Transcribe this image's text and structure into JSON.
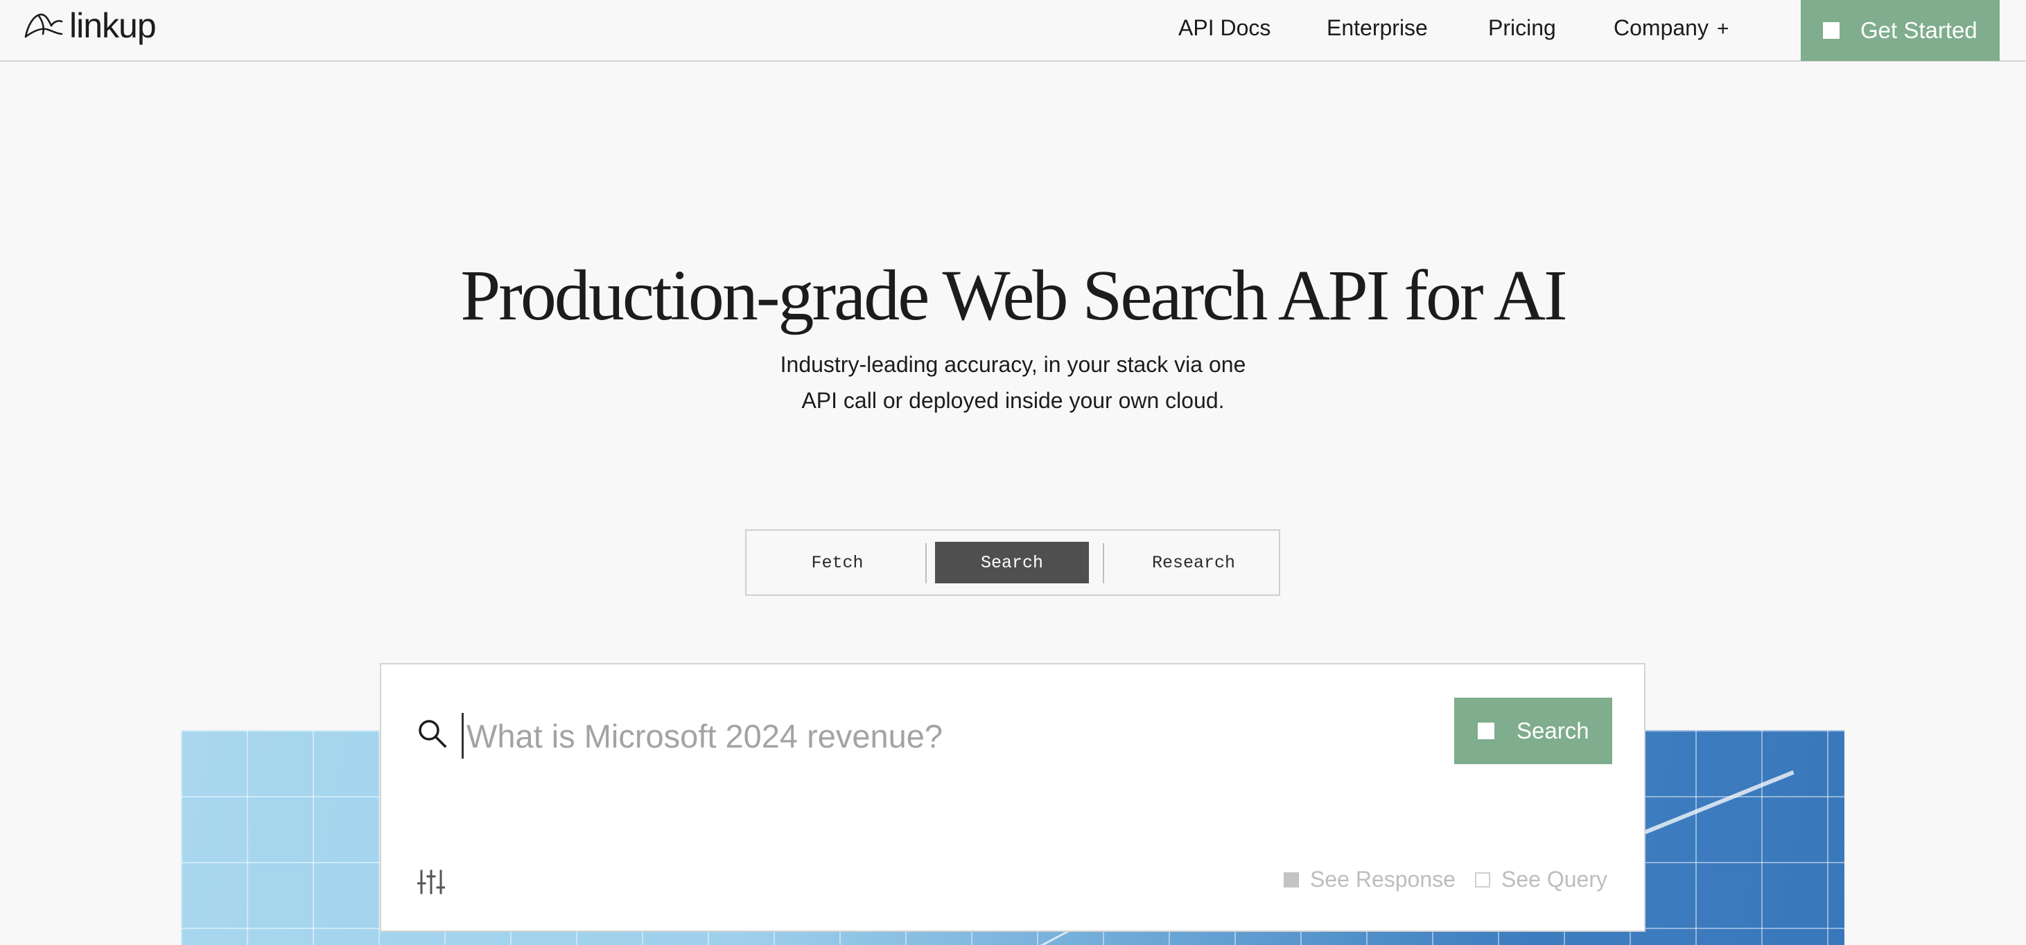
{
  "header": {
    "logo_text": "linkup",
    "nav": [
      {
        "label": "API Docs"
      },
      {
        "label": "Enterprise"
      },
      {
        "label": "Pricing"
      },
      {
        "label": "Company",
        "suffix": "+"
      }
    ],
    "cta_label": "Get Started"
  },
  "hero": {
    "title": "Production-grade Web Search API for AI",
    "subtitle_line1": "Industry-leading accuracy, in your stack via one",
    "subtitle_line2": "API call or deployed inside your own cloud."
  },
  "tabs": [
    {
      "label": "Fetch",
      "active": false
    },
    {
      "label": "Search",
      "active": true
    },
    {
      "label": "Research",
      "active": false
    }
  ],
  "search": {
    "placeholder": "What is Microsoft 2024 revenue?",
    "value": "",
    "button_label": "Search",
    "options": [
      {
        "label": "See Response",
        "checked": true
      },
      {
        "label": "See Query",
        "checked": false
      }
    ]
  },
  "colors": {
    "accent": "#7fad8d",
    "active_tab": "#4f4f4f",
    "background": "#f8f8f8"
  },
  "icons": [
    "logo-icon",
    "search-icon",
    "filter-icon",
    "square-icon"
  ]
}
